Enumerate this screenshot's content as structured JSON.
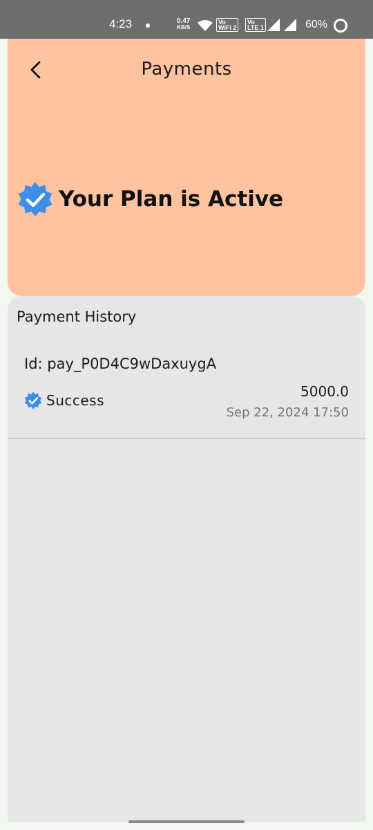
{
  "status_bar": {
    "time": "4:23",
    "net_speed_value": "0.47",
    "net_speed_unit": "KB/S",
    "vowifi_label": "Vo WiFi 2",
    "volte_label": "Vo LTE 1",
    "battery": "60%"
  },
  "header": {
    "title": "Payments",
    "plan_status": "Your Plan is Active",
    "background_color": "#ffc3a0",
    "badge_color": "#3b8fe8"
  },
  "history": {
    "title": "Payment History",
    "items": [
      {
        "id_text": "Id: pay_P0D4C9wDaxuygA",
        "status": "Success",
        "amount": "5000.0",
        "date": "Sep 22, 2024 17:50"
      }
    ]
  }
}
